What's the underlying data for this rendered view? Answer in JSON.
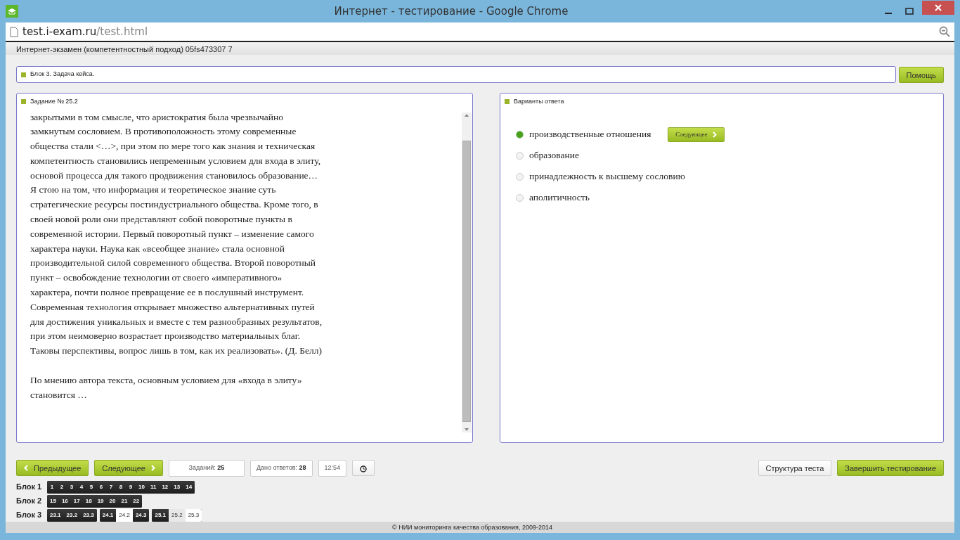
{
  "window": {
    "title": "Интернет - тестирование - Google Chrome"
  },
  "address_bar": {
    "host": "test.i-exam.ru",
    "path": "/test.html"
  },
  "header": {
    "title": "Интернет-экзамен (компетентностный подход) 05fs473307 7"
  },
  "block_bar": {
    "title": "Блок 3. Задача кейса.",
    "help_button": "Помощь"
  },
  "task": {
    "title": "Задание № 25.2",
    "paragraphs": [
      "закрытыми в том смысле, что аристократия была чрезвычайно замкнутым сословием. В противоположность этому современные общества стали <…>, при этом по мере того как знания и техническая компетентность становились непременным условием для входа в элиту, основой процесса для такого продвижения становилось образование… Я стою на том, что информация и теоретическое знание суть стратегические ресурсы постиндустриального общества. Кроме того, в своей новой роли они представляют собой поворотные пункты в современной истории. Первый поворотный пункт – изменение самого характера науки. Наука как «всеобщее знание» стала основной производительной силой современного общества. Второй поворотный пункт – освобождение технологии от своего «императивного» характера, почти полное превращение ее в послушный инструмент. Современная технология открывает множество альтернативных путей для достижения уникальных и вместе с тем разнообразных результатов, при этом неимоверно возрастает производство материальных благ. Таковы перспективы, вопрос лишь в том, как их реализовать». (Д. Белл)",
      "По мнению автора текста, основным условием для «входа в элиту» становится …"
    ]
  },
  "answers": {
    "title": "Варианты ответа",
    "next_button": "Следующее",
    "options": [
      {
        "label": "производственные отношения",
        "selected": true
      },
      {
        "label": "образование",
        "selected": false
      },
      {
        "label": "принадлежность к высшему сословию",
        "selected": false
      },
      {
        "label": "аполитичность",
        "selected": false
      }
    ]
  },
  "toolbar": {
    "prev_button": "Предыдущее",
    "next_button": "Следующее",
    "tasks_label": "Заданий:",
    "tasks_count": "25",
    "answered_label": "Дано ответов:",
    "answered_count": "28",
    "timer": "12:54",
    "structure_button": "Структура теста",
    "finish_button": "Завершить тестирование"
  },
  "blocks": [
    {
      "label": "Блок 1",
      "groups": [
        {
          "items": [
            {
              "label": "1",
              "answered": true,
              "selected": false
            },
            {
              "label": "2",
              "answered": true,
              "selected": false
            },
            {
              "label": "3",
              "answered": true,
              "selected": false
            },
            {
              "label": "4",
              "answered": true,
              "selected": false
            },
            {
              "label": "5",
              "answered": true,
              "selected": false
            },
            {
              "label": "6",
              "answered": true,
              "selected": false
            },
            {
              "label": "7",
              "answered": true,
              "selected": false
            },
            {
              "label": "8",
              "answered": true,
              "selected": false
            },
            {
              "label": "9",
              "answered": true,
              "selected": false
            },
            {
              "label": "10",
              "answered": true,
              "selected": false
            },
            {
              "label": "11",
              "answered": true,
              "selected": false
            },
            {
              "label": "12",
              "answered": true,
              "selected": false
            },
            {
              "label": "13",
              "answered": true,
              "selected": false
            },
            {
              "label": "14",
              "answered": true,
              "selected": false
            }
          ]
        }
      ]
    },
    {
      "label": "Блок 2",
      "groups": [
        {
          "items": [
            {
              "label": "15",
              "answered": true,
              "selected": false
            },
            {
              "label": "16",
              "answered": true,
              "selected": false
            },
            {
              "label": "17",
              "answered": true,
              "selected": false
            },
            {
              "label": "18",
              "answered": true,
              "selected": false
            },
            {
              "label": "19",
              "answered": true,
              "selected": false
            },
            {
              "label": "20",
              "answered": true,
              "selected": false
            },
            {
              "label": "21",
              "answered": true,
              "selected": false
            },
            {
              "label": "22",
              "answered": true,
              "selected": false
            }
          ]
        }
      ]
    },
    {
      "label": "Блок 3",
      "groups": [
        {
          "items": [
            {
              "label": "23.1",
              "answered": true,
              "selected": false
            },
            {
              "label": "23.2",
              "answered": true,
              "selected": false
            },
            {
              "label": "23.3",
              "answered": true,
              "selected": false
            }
          ]
        },
        {
          "items": [
            {
              "label": "24.1",
              "answered": true,
              "selected": false
            },
            {
              "label": "24.2",
              "answered": false,
              "selected": false
            },
            {
              "label": "24.3",
              "answered": true,
              "selected": false
            }
          ]
        },
        {
          "items": [
            {
              "label": "25.1",
              "answered": true,
              "selected": false
            },
            {
              "label": "25.2",
              "answered": false,
              "selected": true
            },
            {
              "label": "25.3",
              "answered": false,
              "selected": false
            }
          ]
        }
      ]
    }
  ],
  "footer": {
    "text": "© НИИ мониторинга качества образования, 2009-2014"
  }
}
